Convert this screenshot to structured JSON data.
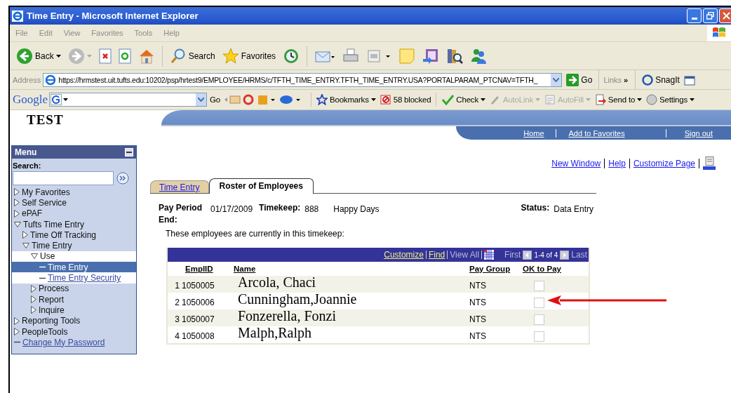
{
  "window": {
    "title": "Time Entry - Microsoft Internet Explorer"
  },
  "menu_bar": [
    "File",
    "Edit",
    "View",
    "Favorites",
    "Tools",
    "Help"
  ],
  "toolbar": [
    {
      "kind": "back",
      "label": "Back"
    },
    {
      "kind": "forward"
    },
    {
      "kind": "stop"
    },
    {
      "kind": "refresh"
    },
    {
      "kind": "home"
    },
    {
      "kind": "search",
      "label": "Search"
    },
    {
      "kind": "favorites",
      "label": "Favorites"
    },
    {
      "kind": "history"
    },
    {
      "kind": "mail"
    },
    {
      "kind": "print"
    },
    {
      "kind": "word"
    },
    {
      "kind": "note"
    },
    {
      "kind": "onenote"
    },
    {
      "kind": "research"
    },
    {
      "kind": "messenger"
    }
  ],
  "address_bar": {
    "label": "Address",
    "url": "https://hrmstest.uit.tufts.edu:10202/psp/hrtest9/EMPLOYEE/HRMS/c/TFTH_TIME_ENTRY.TFTH_TIME_ENTRY.USA?PORTALPARAM_PTCNAV=TFTH_",
    "go": "Go",
    "links": "Links",
    "links_more": "»",
    "snagit": "SnagIt"
  },
  "google_bar": {
    "logo": "Google",
    "items": [
      {
        "kind": "go",
        "label": "Go",
        "disabled": false
      },
      {
        "kind": "bookmarks",
        "label": "Bookmarks",
        "disabled": false
      },
      {
        "kind": "blocked",
        "label": "58 blocked",
        "disabled": false
      },
      {
        "kind": "check",
        "label": "Check",
        "disabled": false
      },
      {
        "kind": "autolink",
        "label": "AutoLink",
        "disabled": true
      },
      {
        "kind": "autofill",
        "label": "AutoFill",
        "disabled": true
      },
      {
        "kind": "sendto",
        "label": "Send to",
        "disabled": false
      },
      {
        "kind": "settings",
        "label": "Settings",
        "disabled": false
      }
    ]
  },
  "page": {
    "site_title": "TEST",
    "header_links": [
      "Home",
      "Add to Favorites",
      "Sign out"
    ],
    "menu": {
      "title": "Menu",
      "search_label": "Search:",
      "items": [
        {
          "kind": "folder",
          "label": "My Favorites",
          "expanded": false
        },
        {
          "kind": "folder",
          "label": "Self Service",
          "expanded": false
        },
        {
          "kind": "folder",
          "label": "ePAF",
          "expanded": false
        },
        {
          "kind": "folder",
          "label": "Tufts Time Entry",
          "expanded": true,
          "children": [
            {
              "kind": "folder",
              "label": "Time Off Tracking",
              "expanded": false
            },
            {
              "kind": "folder",
              "label": "Time Entry",
              "expanded": true,
              "children": [
                {
                  "kind": "folder",
                  "label": "Use",
                  "expanded": true,
                  "children": [
                    {
                      "kind": "link",
                      "label": "Time Entry",
                      "selected": true
                    },
                    {
                      "kind": "link",
                      "label": "Time Entry Security",
                      "selected": false
                    }
                  ]
                },
                {
                  "kind": "folder",
                  "label": "Process",
                  "expanded": false
                },
                {
                  "kind": "folder",
                  "label": "Report",
                  "expanded": false
                },
                {
                  "kind": "folder",
                  "label": "Inquire",
                  "expanded": false
                }
              ]
            }
          ]
        },
        {
          "kind": "folder",
          "label": "Reporting Tools",
          "expanded": false
        },
        {
          "kind": "folder",
          "label": "PeopleTools",
          "expanded": false
        },
        {
          "kind": "link",
          "label": "Change My Password",
          "selected": false
        }
      ]
    },
    "page_links": [
      "New Window",
      "Help",
      "Customize Page"
    ],
    "tabs": [
      {
        "label": "Time Entry",
        "selected": false
      },
      {
        "label": "Roster of Employees",
        "selected": true
      }
    ],
    "pay_period_label": "Pay Period End:",
    "pay_period": "01/17/2009",
    "timekeep_label": "Timekeep:",
    "timekeep_id": "888",
    "timekeep_name": "Happy Days",
    "status_label": "Status:",
    "status": "Data Entry",
    "instruction": "These employees are currently in this timekeep:",
    "grid": {
      "nav": {
        "customize": "Customize",
        "find": "Find",
        "view_all": "View All",
        "first": "First",
        "range": "1-4 of 4",
        "last": "Last"
      },
      "columns": [
        "EmplID",
        "Name",
        "Pay Group",
        "OK to Pay"
      ],
      "rows": [
        {
          "number": "1",
          "empl_id": "1050005",
          "name": "Arcola, Chaci",
          "pay_group": "NTS",
          "checked": false
        },
        {
          "number": "2",
          "empl_id": "1050006",
          "name": "Cunningham,Joannie",
          "pay_group": "NTS",
          "checked": false
        },
        {
          "number": "3",
          "empl_id": "1050007",
          "name": "Fonzerella, Fonzi",
          "pay_group": "NTS",
          "checked": false
        },
        {
          "number": "4",
          "empl_id": "1050008",
          "name": "Malph,Ralph",
          "pay_group": "NTS",
          "checked": false
        }
      ]
    }
  }
}
